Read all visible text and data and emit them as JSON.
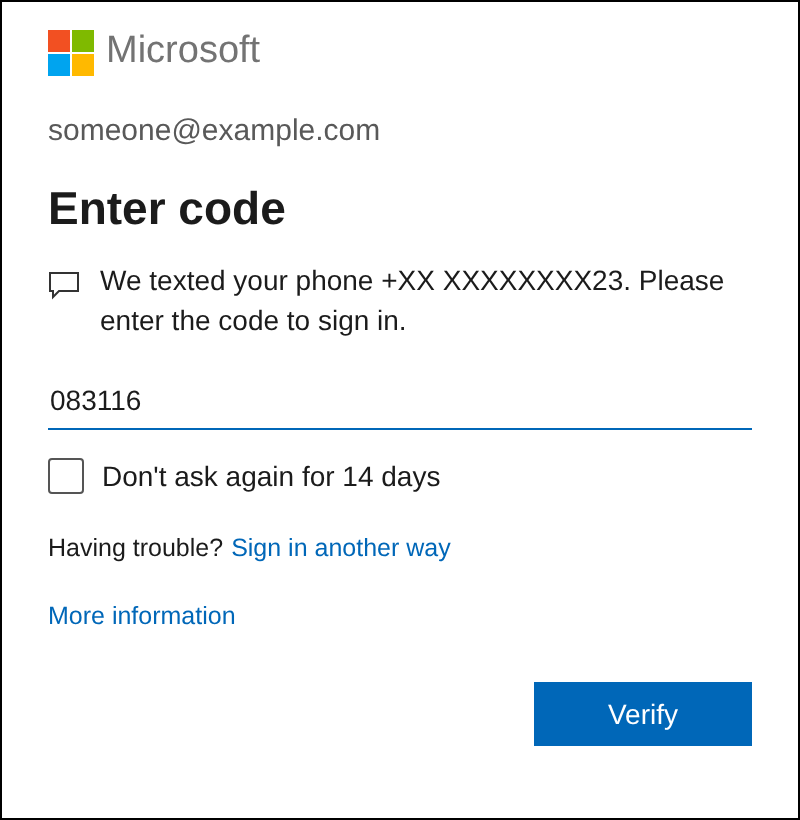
{
  "brand": {
    "name": "Microsoft"
  },
  "account": "someone@example.com",
  "title": "Enter code",
  "message": "We texted your phone +XX XXXXXXXX23. Please enter the code to sign in.",
  "code_field": {
    "value": "083116"
  },
  "remember": {
    "label": "Don't ask again for 14 days",
    "checked": false
  },
  "trouble": {
    "text": "Having trouble?",
    "link": "Sign in another way"
  },
  "more_link": "More information",
  "buttons": [
    {
      "label": "Verify"
    }
  ]
}
